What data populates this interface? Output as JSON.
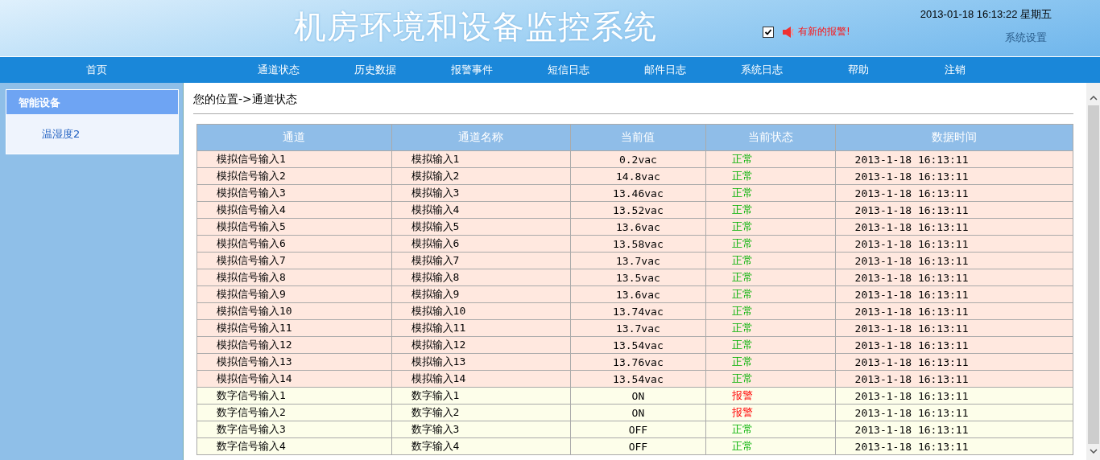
{
  "header": {
    "title": "机房环境和设备监控系统",
    "alarm_enabled": true,
    "alarm_text": "有新的报警!",
    "datetime": "2013-01-18 16:13:22 星期五",
    "settings_link": "系统设置"
  },
  "nav": [
    {
      "label": "首页"
    },
    {
      "label": "通道状态"
    },
    {
      "label": "历史数据"
    },
    {
      "label": "报警事件"
    },
    {
      "label": "短信日志"
    },
    {
      "label": "邮件日志"
    },
    {
      "label": "系统日志"
    },
    {
      "label": "帮助"
    },
    {
      "label": "注销"
    }
  ],
  "sidebar": {
    "heading": "智能设备",
    "items": [
      {
        "label": "温湿度2"
      }
    ]
  },
  "breadcrumb": "您的位置->通道状态",
  "table": {
    "columns": [
      "通道",
      "通道名称",
      "当前值",
      "当前状态",
      "数据时间"
    ],
    "rows": [
      {
        "kind": "analog",
        "channel": "模拟信号输入1",
        "name": "模拟输入1",
        "value": "0.2vac",
        "status": "正常",
        "alarm": false,
        "time": "2013-1-18 16:13:11"
      },
      {
        "kind": "analog",
        "channel": "模拟信号输入2",
        "name": "模拟输入2",
        "value": "14.8vac",
        "status": "正常",
        "alarm": false,
        "time": "2013-1-18 16:13:11"
      },
      {
        "kind": "analog",
        "channel": "模拟信号输入3",
        "name": "模拟输入3",
        "value": "13.46vac",
        "status": "正常",
        "alarm": false,
        "time": "2013-1-18 16:13:11"
      },
      {
        "kind": "analog",
        "channel": "模拟信号输入4",
        "name": "模拟输入4",
        "value": "13.52vac",
        "status": "正常",
        "alarm": false,
        "time": "2013-1-18 16:13:11"
      },
      {
        "kind": "analog",
        "channel": "模拟信号输入5",
        "name": "模拟输入5",
        "value": "13.6vac",
        "status": "正常",
        "alarm": false,
        "time": "2013-1-18 16:13:11"
      },
      {
        "kind": "analog",
        "channel": "模拟信号输入6",
        "name": "模拟输入6",
        "value": "13.58vac",
        "status": "正常",
        "alarm": false,
        "time": "2013-1-18 16:13:11"
      },
      {
        "kind": "analog",
        "channel": "模拟信号输入7",
        "name": "模拟输入7",
        "value": "13.7vac",
        "status": "正常",
        "alarm": false,
        "time": "2013-1-18 16:13:11"
      },
      {
        "kind": "analog",
        "channel": "模拟信号输入8",
        "name": "模拟输入8",
        "value": "13.5vac",
        "status": "正常",
        "alarm": false,
        "time": "2013-1-18 16:13:11"
      },
      {
        "kind": "analog",
        "channel": "模拟信号输入9",
        "name": "模拟输入9",
        "value": "13.6vac",
        "status": "正常",
        "alarm": false,
        "time": "2013-1-18 16:13:11"
      },
      {
        "kind": "analog",
        "channel": "模拟信号输入10",
        "name": "模拟输入10",
        "value": "13.74vac",
        "status": "正常",
        "alarm": false,
        "time": "2013-1-18 16:13:11"
      },
      {
        "kind": "analog",
        "channel": "模拟信号输入11",
        "name": "模拟输入11",
        "value": "13.7vac",
        "status": "正常",
        "alarm": false,
        "time": "2013-1-18 16:13:11"
      },
      {
        "kind": "analog",
        "channel": "模拟信号输入12",
        "name": "模拟输入12",
        "value": "13.54vac",
        "status": "正常",
        "alarm": false,
        "time": "2013-1-18 16:13:11"
      },
      {
        "kind": "analog",
        "channel": "模拟信号输入13",
        "name": "模拟输入13",
        "value": "13.76vac",
        "status": "正常",
        "alarm": false,
        "time": "2013-1-18 16:13:11"
      },
      {
        "kind": "analog",
        "channel": "模拟信号输入14",
        "name": "模拟输入14",
        "value": "13.54vac",
        "status": "正常",
        "alarm": false,
        "time": "2013-1-18 16:13:11"
      },
      {
        "kind": "digital",
        "channel": "数字信号输入1",
        "name": "数字输入1",
        "value": "ON",
        "status": "报警",
        "alarm": true,
        "time": "2013-1-18 16:13:11"
      },
      {
        "kind": "digital",
        "channel": "数字信号输入2",
        "name": "数字输入2",
        "value": "ON",
        "status": "报警",
        "alarm": true,
        "time": "2013-1-18 16:13:11"
      },
      {
        "kind": "digital",
        "channel": "数字信号输入3",
        "name": "数字输入3",
        "value": "OFF",
        "status": "正常",
        "alarm": false,
        "time": "2013-1-18 16:13:11"
      },
      {
        "kind": "digital",
        "channel": "数字信号输入4",
        "name": "数字输入4",
        "value": "OFF",
        "status": "正常",
        "alarm": false,
        "time": "2013-1-18 16:13:11"
      }
    ]
  }
}
